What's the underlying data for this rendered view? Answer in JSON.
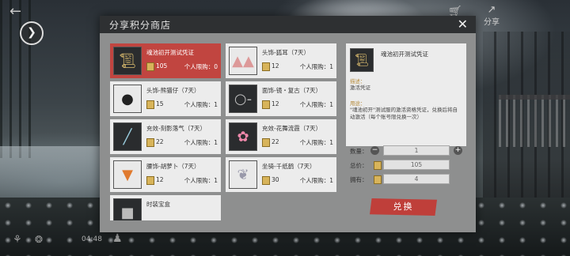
{
  "hud": {
    "back_icon": "back-arrow-icon",
    "expand_icon": "chevron-right-icon",
    "share_label": "分享",
    "time": "04:48"
  },
  "shop": {
    "title": "分享积分商店",
    "items": [
      {
        "name": "魂池初开测试凭证",
        "cost": "105",
        "limit": "个人限购：0",
        "icon": "scroll-icon",
        "selected": true
      },
      {
        "name": "头饰-狐耳（7天）",
        "cost": "12",
        "limit": "个人限购：1",
        "icon": "fox-ears-icon"
      },
      {
        "name": "头饰-熊猫仔（7天）",
        "cost": "15",
        "limit": "个人限购：1",
        "icon": "panda-icon"
      },
      {
        "name": "面饰-镜・复古（7天）",
        "cost": "12",
        "limit": "个人限购：1",
        "icon": "glasses-icon"
      },
      {
        "name": "充效-刻影落气（7天）",
        "cost": "22",
        "limit": "个人限购：1",
        "icon": "sword-effect-icon"
      },
      {
        "name": "充效-花舞流霞（7天）",
        "cost": "22",
        "limit": "个人限购：1",
        "icon": "flower-effect-icon"
      },
      {
        "name": "腰饰-胡萝卜（7天）",
        "cost": "12",
        "limit": "个人限购：1",
        "icon": "carrot-icon"
      },
      {
        "name": "坐骑-千纸鹤（7天）",
        "cost": "30",
        "limit": "个人限购：1",
        "icon": "paper-crane-icon"
      },
      {
        "name": "时装宝盒",
        "cost": "",
        "limit": "",
        "icon": "box-icon"
      }
    ],
    "detail": {
      "name": "魂池初开测试凭证",
      "desc_label": "描述：",
      "desc": "激活凭证",
      "usage_label": "用途：",
      "usage": "\"魂池初开\"测试服的激活资格凭证，兑换后将自动激活（每个账号限兑换一次）"
    },
    "form": {
      "qty_label": "数量：",
      "qty_value": "1",
      "total_label": "总价：",
      "total_value": "105",
      "owned_label": "拥有：",
      "owned_value": "4"
    },
    "exchange_label": "兑换"
  }
}
